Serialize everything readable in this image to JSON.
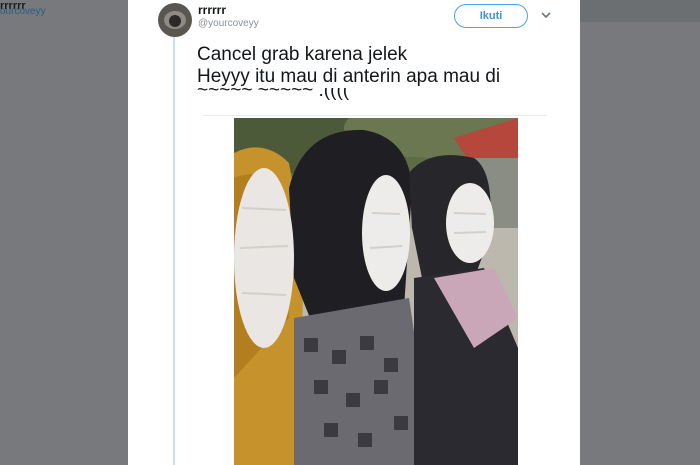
{
  "background": {
    "left_name": "rrrrrr",
    "left_handle": "ourcoveyy"
  },
  "tweet": {
    "user_name": "rrrrrr",
    "user_handle": "@yourcoveyy",
    "follow_label": "Ikuti",
    "chevron": "⌄",
    "text_line1": "Cancel grab karena jelek",
    "text_line2": "Heyyy itu mau di anterin apa mau di",
    "text_line3": "~~~~~  ~~~~~  :(((("
  },
  "colors": {
    "accent": "#3b94d9",
    "thread": "#c3e1f7",
    "backdrop": "#7a7d80"
  },
  "icons": {
    "more": "chevron-down-icon"
  }
}
